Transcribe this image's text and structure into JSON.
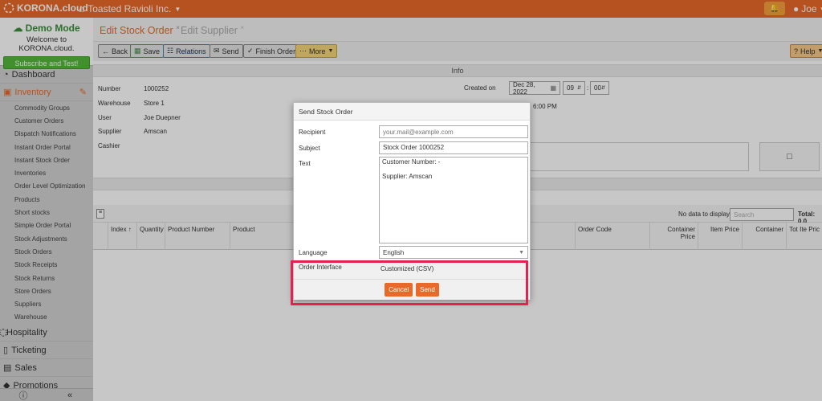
{
  "topbar": {
    "brand": "KORONA.cloud",
    "company": "Toasted Ravioli Inc.",
    "user": "Joe",
    "colors": {
      "accent": "#e8692a"
    }
  },
  "sidebar": {
    "demo_title": "Demo Mode",
    "demo_welcome": "Welcome to KORONA.cloud.",
    "subscribe_label": "Subscribe and Test!",
    "items": [
      {
        "label": "Dashboard",
        "icon": "gauge-icon"
      },
      {
        "label": "Inventory",
        "icon": "gift-icon",
        "active": true
      },
      {
        "label": "Hospitality",
        "icon": "cutlery-icon"
      },
      {
        "label": "Ticketing",
        "icon": "ticket-icon"
      },
      {
        "label": "Sales",
        "icon": "receipt-icon"
      },
      {
        "label": "Promotions",
        "icon": "tag-icon"
      }
    ],
    "subitems": [
      "Commodity Groups",
      "Customer Orders",
      "Dispatch Notifications",
      "Instant Order Portal",
      "Instant Stock Order",
      "Inventories",
      "Order Level Optimization",
      "Products",
      "Short stocks",
      "Simple Order Portal",
      "Stock Adjustments",
      "Stock Orders",
      "Stock Receipts",
      "Stock Returns",
      "Store Orders",
      "Suppliers",
      "Warehouse"
    ]
  },
  "tabs": [
    {
      "label": "Edit Stock Order",
      "active": true
    },
    {
      "label": "Edit Supplier",
      "active": false
    }
  ],
  "toolbar": {
    "back": "Back",
    "save": "Save",
    "relations": "Relations",
    "send": "Send",
    "finish": "Finish Order",
    "more": "More",
    "help": "Help"
  },
  "info": {
    "header": "Info",
    "number_label": "Number",
    "number": "1000252",
    "warehouse_label": "Warehouse",
    "warehouse": "Store 1",
    "user_label": "User",
    "user": "Joe Duepner",
    "supplier_label": "Supplier",
    "supplier": "Amscan",
    "cashier_label": "Cashier",
    "created_label": "Created on",
    "created_date": "Dec 28, 2022",
    "created_hour": "09",
    "created_min": "00",
    "time_partial": "6:00 PM"
  },
  "grid": {
    "no_data": "No data to display",
    "search_placeholder": "Search",
    "total_label": "Total: 0.0",
    "columns": [
      "Index ↑",
      "Quantity",
      "Product Number",
      "Product",
      "Order Code",
      "Container Price",
      "Item Price",
      "Container",
      "Tot Ite Pric"
    ]
  },
  "dialog": {
    "title": "Send Stock Order",
    "recipient_label": "Recipient",
    "recipient_placeholder": "your.mail@example.com",
    "subject_label": "Subject",
    "subject_value": "Stock Order 1000252",
    "text_label": "Text",
    "text_line1": "Customer Number: -",
    "text_line2": "Supplier: Amscan",
    "language_label": "Language",
    "language_value": "English",
    "interface_label": "Order Interface",
    "interface_value": "Customized (CSV)",
    "cancel": "Cancel",
    "send": "Send",
    "highlight_color": "#e5214f"
  }
}
